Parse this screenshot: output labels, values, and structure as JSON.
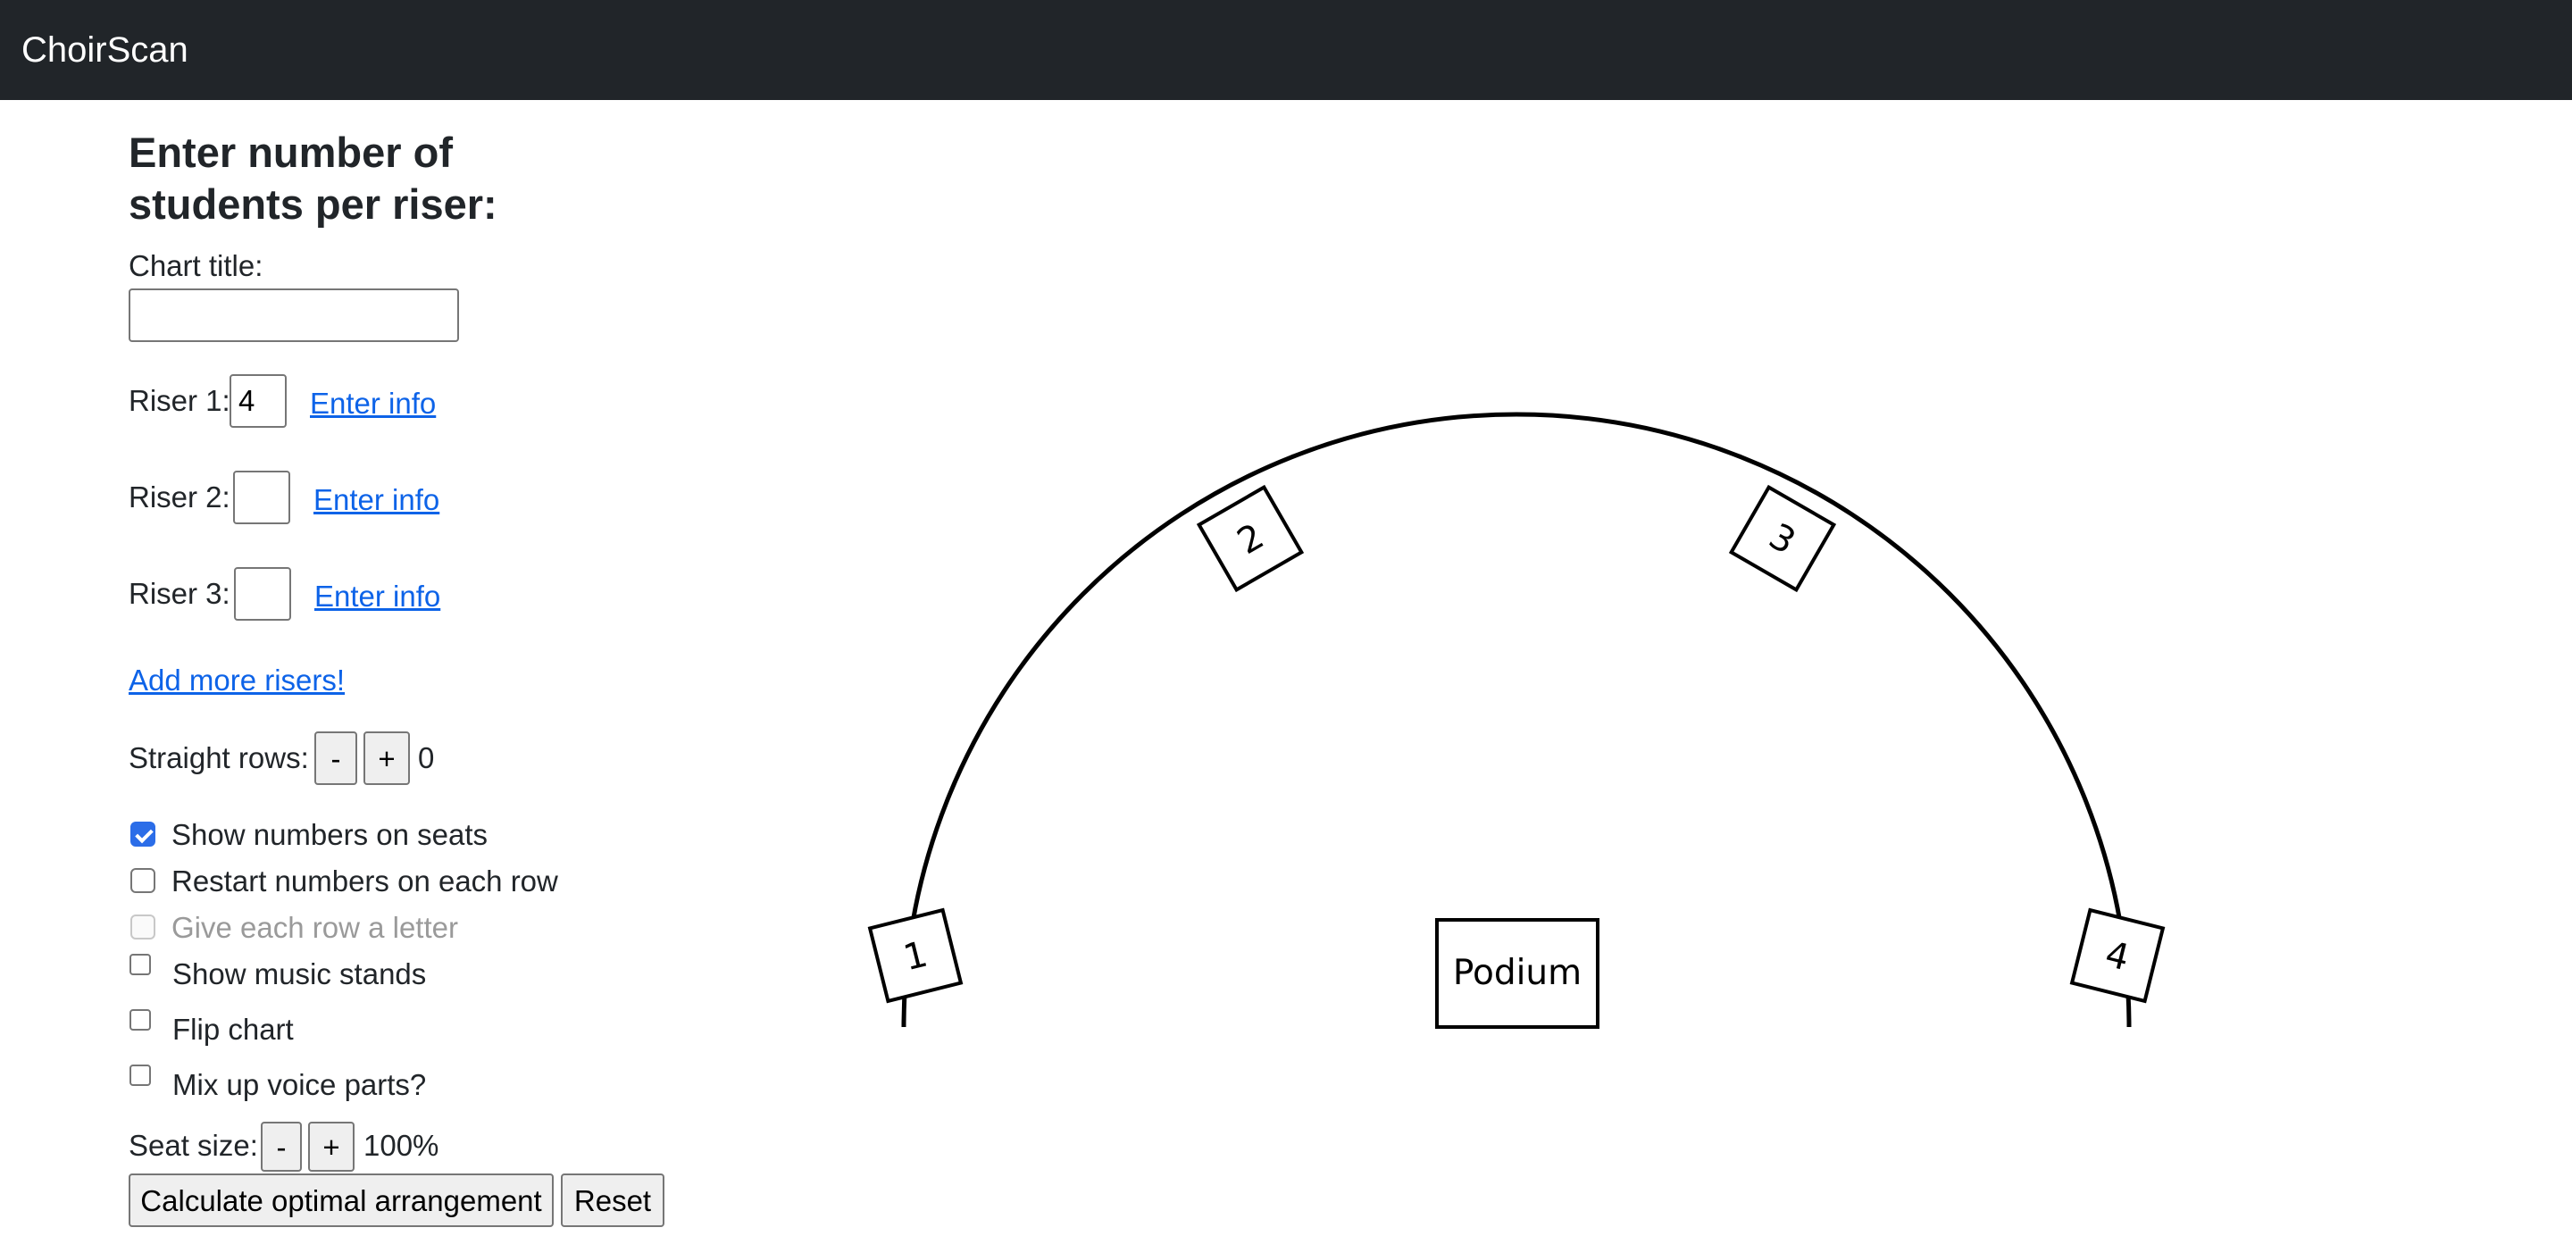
{
  "app": {
    "brand": "ChoirScan"
  },
  "form": {
    "heading": "Enter number of students per riser:",
    "chart_title_label": "Chart title:",
    "chart_title_value": "",
    "risers": [
      {
        "label": "Riser 1:",
        "value": "4",
        "link": "Enter info"
      },
      {
        "label": "Riser 2:",
        "value": "",
        "link": "Enter info"
      },
      {
        "label": "Riser 3:",
        "value": "",
        "link": "Enter info"
      }
    ],
    "add_risers_link": "Add more risers!",
    "straight_rows": {
      "label": "Straight rows:",
      "minus": "-",
      "plus": "+",
      "value": "0"
    },
    "options": [
      {
        "label": "Show numbers on seats",
        "checked": true,
        "disabled": false
      },
      {
        "label": "Restart numbers on each row",
        "checked": false,
        "disabled": false
      },
      {
        "label": "Give each row a letter",
        "checked": false,
        "disabled": true
      },
      {
        "label": "Show music stands",
        "checked": false,
        "disabled": false
      },
      {
        "label": "Flip chart",
        "checked": false,
        "disabled": false
      },
      {
        "label": "Mix up voice parts?",
        "checked": false,
        "disabled": false
      }
    ],
    "seat_size": {
      "label": "Seat size:",
      "minus": "-",
      "plus": "+",
      "value": "100%"
    },
    "calculate_button": "Calculate optimal arrangement",
    "reset_button": "Reset"
  },
  "stage": {
    "podium_label": "Podium",
    "seats": [
      "1",
      "2",
      "3",
      "4"
    ]
  }
}
